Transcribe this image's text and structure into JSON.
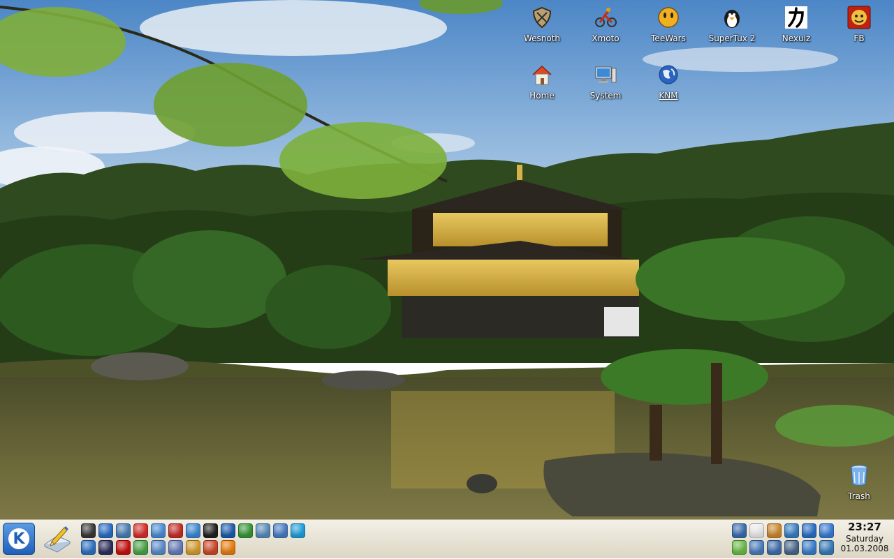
{
  "desktop": {
    "icons_top": [
      {
        "label": "Wesnoth",
        "icon": "shield-icon"
      },
      {
        "label": "Xmoto",
        "icon": "motorbike-icon"
      },
      {
        "label": "TeeWars",
        "icon": "smiley-icon"
      },
      {
        "label": "SuperTux 2",
        "icon": "penguin-icon"
      },
      {
        "label": "Nexuiz",
        "icon": "kanji-icon"
      },
      {
        "label": "FB",
        "icon": "fb-icon"
      }
    ],
    "icons_second": [
      {
        "label": "Home",
        "icon": "home-icon"
      },
      {
        "label": "System",
        "icon": "computer-icon"
      },
      {
        "label": "KNM",
        "icon": "globe-icon"
      }
    ],
    "trash": {
      "label": "Trash",
      "icon": "trash-icon"
    }
  },
  "panel": {
    "kmenu_letter": "K",
    "quick_launch": [
      {
        "icon": "monitor-icon",
        "color": "#3a3a3a"
      },
      {
        "icon": "konqueror-icon",
        "color": "#2a6fc9"
      },
      {
        "icon": "network-icon",
        "color": "#4a7fb8"
      },
      {
        "icon": "help-lifebuoy-icon",
        "color": "#d9302c"
      },
      {
        "icon": "bug-icon",
        "color": "#4a90d9"
      },
      {
        "icon": "calendar-icon",
        "color": "#c9302c"
      },
      {
        "icon": "kget-icon",
        "color": "#3d8bd8"
      },
      {
        "icon": "ufo-icon",
        "color": "#222222"
      },
      {
        "icon": "globe-browser-icon",
        "color": "#1d5fb0"
      },
      {
        "icon": "download-arrow-icon",
        "color": "#3a9a3a"
      },
      {
        "icon": "network-computer-icon",
        "color": "#5a8fc0"
      },
      {
        "icon": "settings-icon",
        "color": "#4a7fc9"
      },
      {
        "icon": "skype-icon",
        "color": "#1fa3e0"
      },
      {
        "icon": "editor-icon",
        "color": "#2f74c8"
      },
      {
        "icon": "terminal-icon",
        "color": "#303060"
      },
      {
        "icon": "opera-icon",
        "color": "#cc1010"
      },
      {
        "icon": "dice-icon",
        "color": "#4aa84a"
      },
      {
        "icon": "screenshot-icon",
        "color": "#5b8fd0"
      },
      {
        "icon": "pencil-icon",
        "color": "#6a7fc0"
      },
      {
        "icon": "notes-icon",
        "color": "#d9a030"
      },
      {
        "icon": "arrows-icon",
        "color": "#d24a2a"
      },
      {
        "icon": "vlc-icon",
        "color": "#f08010"
      }
    ],
    "tray_icons": [
      {
        "icon": "network-tray-icon",
        "color": "#3a6fb0"
      },
      {
        "icon": "klipper-icon",
        "color": "#f0f0f0"
      },
      {
        "icon": "user-icon",
        "color": "#d08a30"
      },
      {
        "icon": "display-icon",
        "color": "#3a80c8"
      },
      {
        "icon": "browser-tray-icon",
        "color": "#2a70c8"
      },
      {
        "icon": "updates-icon",
        "color": "#3a7fd8"
      },
      {
        "icon": "status-icon",
        "color": "#6cc04a"
      },
      {
        "icon": "window-list-icon",
        "color": "#4a80c0"
      },
      {
        "icon": "volume-icon",
        "color": "#4070b0"
      },
      {
        "icon": "kde-tray-icon",
        "color": "#4a6a90"
      },
      {
        "icon": "signal-icon",
        "color": "#3a80d0"
      },
      {
        "icon": "wireless-icon",
        "color": "#3a7fc0"
      }
    ],
    "clock": {
      "time": "23:27",
      "day": "Saturday",
      "date": "01.03.2008"
    }
  }
}
